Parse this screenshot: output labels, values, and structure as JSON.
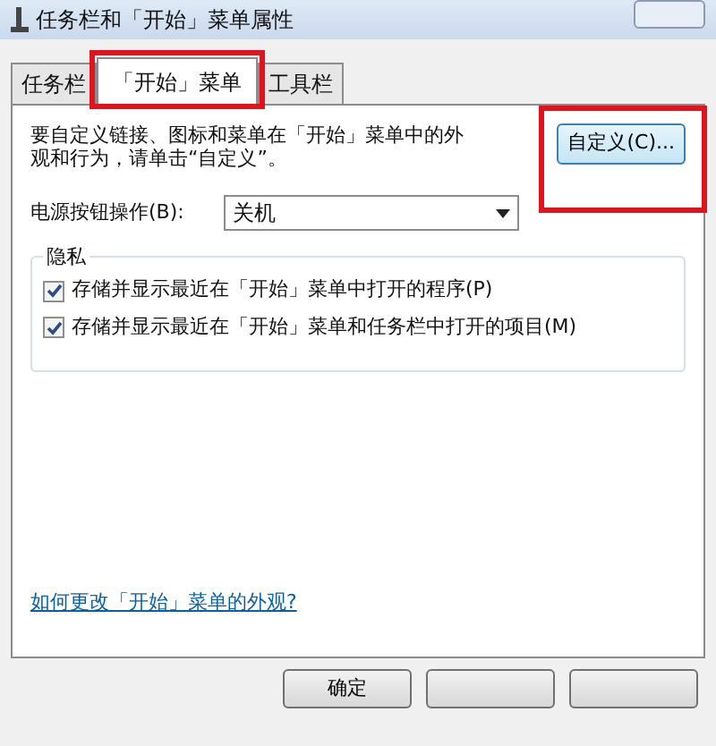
{
  "window": {
    "title": "任务栏和「开始」菜单属性"
  },
  "tabs": [
    {
      "label": "任务栏",
      "selected": false,
      "highlighted": false
    },
    {
      "label": "「开始」菜单",
      "selected": true,
      "highlighted": true
    },
    {
      "label": "工具栏",
      "selected": false,
      "highlighted": false
    }
  ],
  "description": "要自定义链接、图标和菜单在「开始」菜单中的外观和行为，请单击“自定义”。",
  "customize_button": {
    "label": "自定义(C)...",
    "highlighted": true
  },
  "power_button": {
    "label": "电源按钮操作(B):",
    "value": "关机"
  },
  "privacy": {
    "title": "隐私",
    "options": [
      {
        "label": "存储并显示最近在「开始」菜单中打开的程序(P)",
        "checked": true
      },
      {
        "label": "存储并显示最近在「开始」菜单和任务栏中打开的项目(M)",
        "checked": true
      }
    ]
  },
  "help_link": "如何更改「开始」菜单的外观?",
  "buttons": [
    {
      "kind": "text",
      "label": "确定"
    },
    {
      "kind": "blank"
    },
    {
      "kind": "blank"
    }
  ]
}
